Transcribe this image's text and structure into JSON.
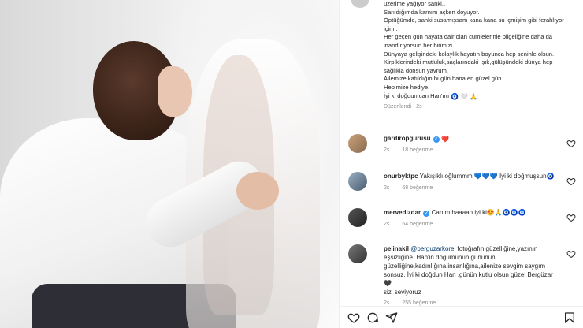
{
  "caption": {
    "lines": [
      "üzerime yağıyor sanki..",
      "Sarıldığımda karnım açken doyuyor.",
      "Öptüğümde, sanki susamışsam kana kana su içmişim gibi ferahlıyor",
      "içim..",
      "Her geçen gün hayata dair olan cümlelerinle bilgeliğine daha da",
      "inandırıyorsun her birimizi.",
      "Dünyaya gelişindeki kolaylık hayatın boyunca hep seninle olsun.",
      "Kirpiklerindeki mutluluk,saçlarındaki ışık,gülüşündeki dünya hep",
      "sağlıkla dönsün yavrum.",
      "Ailemize katıldığın bugün bana en güzel gün..",
      "Hepimize hediye.",
      "İyi ki doğdun can Han'ım"
    ],
    "emoji_after_last": [
      "🧿",
      "🤍",
      "🙏"
    ],
    "time": "Düzenlendi · 2s"
  },
  "comments": [
    {
      "user": "gardiropgurusu",
      "verified": true,
      "text": "",
      "emoji": "❤️",
      "time": "2s",
      "likes": "18 beğenme"
    },
    {
      "user": "onurbyktpc",
      "verified": false,
      "text": "Yakışıklı oğlummm 💙💙💙 İyi ki doğmuşsun🧿",
      "time": "2s",
      "likes": "68 beğenme"
    },
    {
      "user": "mervedizdar",
      "verified": true,
      "text": "Canım haaaan iyi ki😍🙏🧿🧿🧿",
      "time": "2s",
      "likes": "64 beğenme"
    },
    {
      "user": "pelinakil",
      "verified": false,
      "mention": "@berguzarkorel",
      "text_lines": [
        "fotoğrafın güzelliğine,yazının",
        "eşsizliğine. Han'in doğumunun gününün",
        "güzelliğine,kadınlığına,insanlığına,ailenize sevgim saygım",
        "sonsuz. İyi ki doğdun Han .günün kutlu olsun güzel Bergüzar 🖤",
        "sizi seviyoruz"
      ],
      "time": "2s",
      "likes": "255 beğenme"
    }
  ],
  "colors": {
    "heart_red": "#ed4956",
    "verified_blue": "#3897f0",
    "muted_text": "#8e8e8e"
  },
  "icons": [
    "heart-icon",
    "comment-icon",
    "share-icon",
    "bookmark-icon"
  ]
}
